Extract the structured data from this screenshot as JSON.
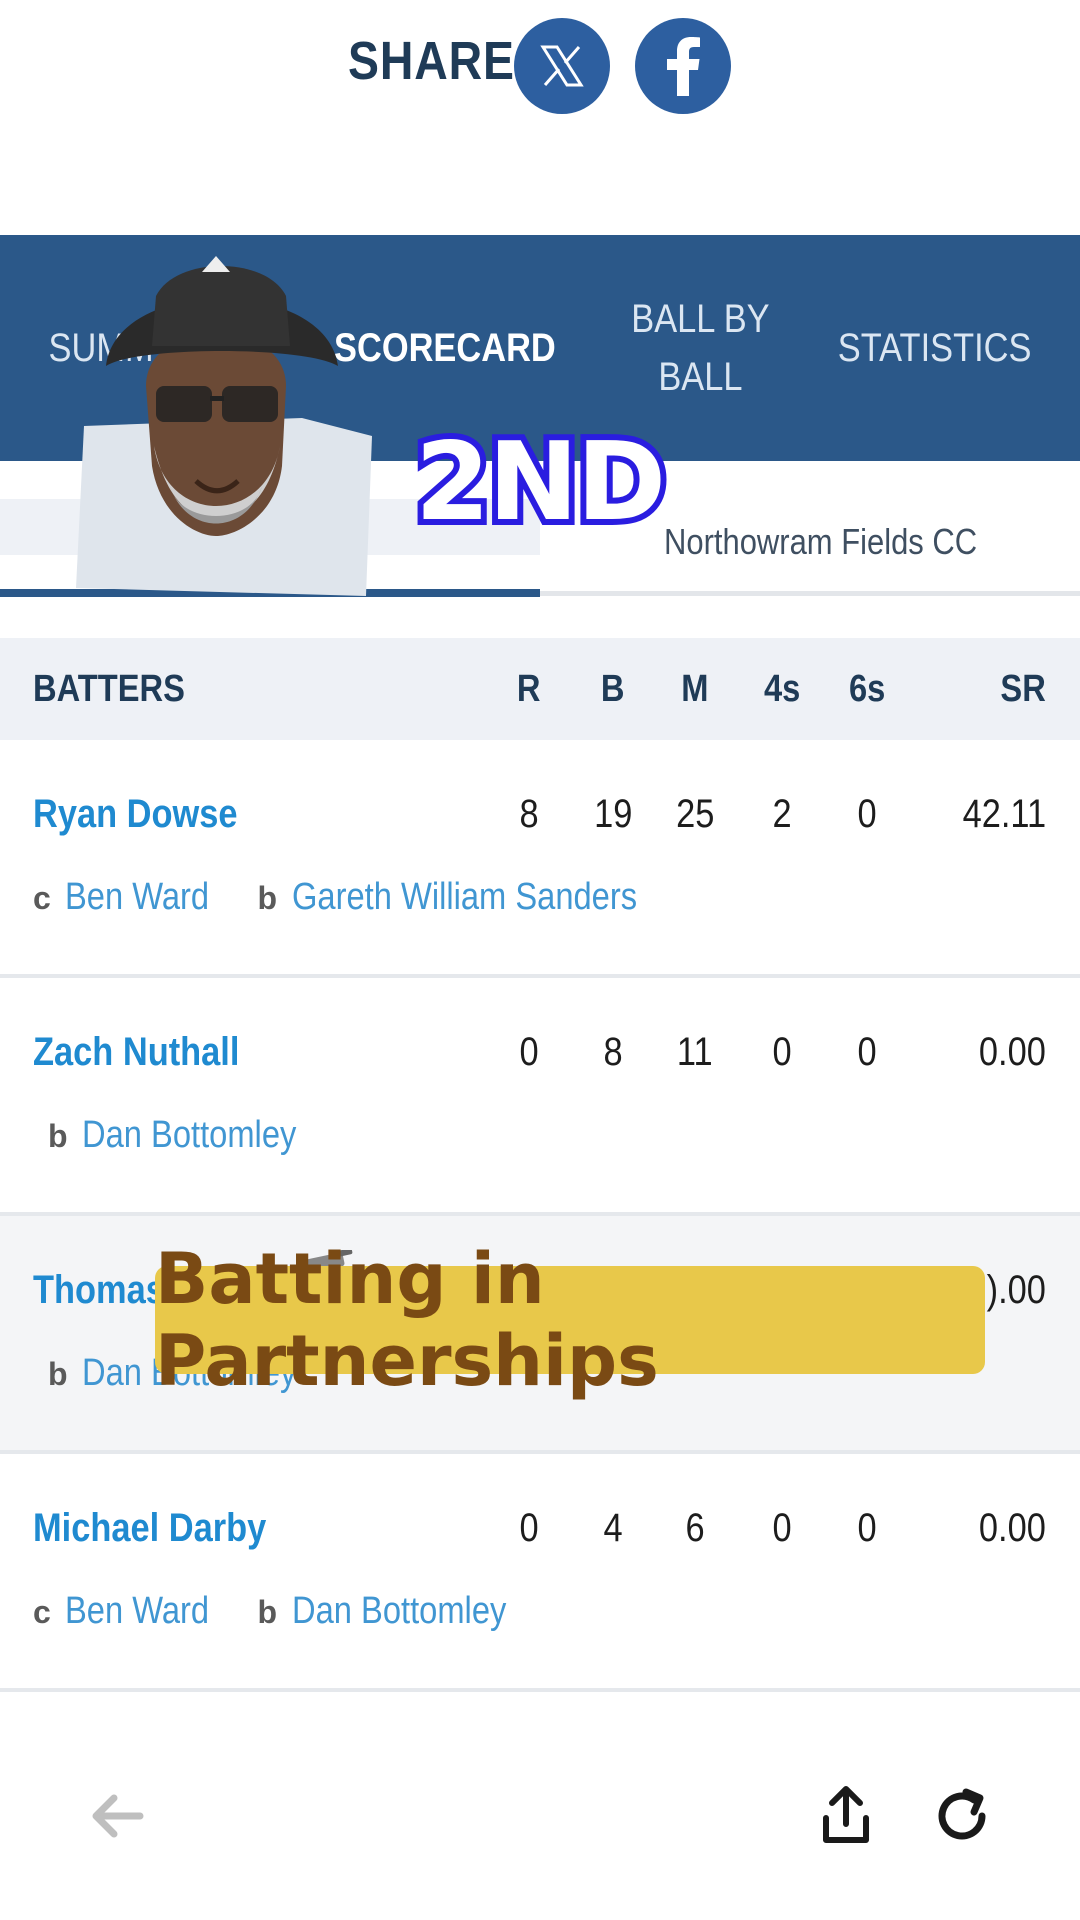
{
  "share": {
    "label": "SHARE",
    "buttons": [
      {
        "icon": "x-logo-icon"
      },
      {
        "icon": "facebook-logo-icon"
      }
    ]
  },
  "tabs": [
    {
      "label": "SUMMARY",
      "visible_text": "SUMM",
      "active": false
    },
    {
      "label": "SCORECARD",
      "active": true
    },
    {
      "label_line1": "BALL BY",
      "label_line2": "BALL",
      "active": false
    },
    {
      "label": "STATISTICS",
      "active": false
    }
  ],
  "innings": {
    "right_team": "Northowram Fields CC"
  },
  "table": {
    "headers": {
      "name": "BATTERS",
      "r": "R",
      "b": "B",
      "m": "M",
      "fours": "4s",
      "sixes": "6s",
      "sr": "SR"
    },
    "rows": [
      {
        "name": "Ryan Dowse",
        "r": "8",
        "b": "19",
        "m": "25",
        "fours": "2",
        "sixes": "0",
        "sr": "42.11",
        "caught_key": "c",
        "caught_by": "Ben Ward",
        "bowled_key": "b",
        "bowled_by": "Gareth William Sanders"
      },
      {
        "name": "Zach Nuthall",
        "r": "0",
        "b": "8",
        "m": "11",
        "fours": "0",
        "sixes": "0",
        "sr": "0.00",
        "bowled_key": "b",
        "bowled_by": "Dan Bottomley"
      },
      {
        "name": "Thomas",
        "sr": ").00",
        "bowled_key": "b",
        "bowled_by": "Dan Bottomley"
      },
      {
        "name": "Michael Darby",
        "r": "0",
        "b": "4",
        "m": "6",
        "fours": "0",
        "sixes": "0",
        "sr": "0.00",
        "caught_key": "c",
        "caught_by": "Ben Ward",
        "bowled_key": "b",
        "bowled_by": "Dan Bottomley"
      }
    ]
  },
  "overlays": {
    "sticker": "2ND",
    "caption": "Batting in Partnerships"
  },
  "colors": {
    "tab_bar": "#2b5889",
    "link_blue": "#1f8ad0",
    "caption_bg": "#e8c84a",
    "caption_text": "#7a4a14",
    "sticker_outline": "#2a1de0"
  },
  "toolbar": {
    "icons": [
      "back-arrow-icon",
      "share-upload-icon",
      "reload-icon"
    ]
  }
}
